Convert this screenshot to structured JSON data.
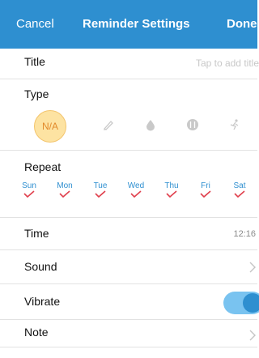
{
  "navbar": {
    "cancel": "Cancel",
    "title": "Reminder Settings",
    "done": "Done"
  },
  "title_row": {
    "label": "Title",
    "placeholder": "Tap to add title"
  },
  "type_row": {
    "label": "Type",
    "selected": "N/A",
    "icons": [
      "pen-icon",
      "drop-icon",
      "fork-knife-icon",
      "exercise-icon"
    ]
  },
  "repeat_row": {
    "label": "Repeat",
    "days": [
      {
        "name": "Sun",
        "checked": true
      },
      {
        "name": "Mon",
        "checked": true
      },
      {
        "name": "Tue",
        "checked": true
      },
      {
        "name": "Wed",
        "checked": true
      },
      {
        "name": "Thu",
        "checked": true
      },
      {
        "name": "Fri",
        "checked": true
      },
      {
        "name": "Sat",
        "checked": true
      }
    ]
  },
  "time_row": {
    "label": "Time",
    "value": "12:16"
  },
  "sound_row": {
    "label": "Sound"
  },
  "vibrate_row": {
    "label": "Vibrate",
    "on": true
  },
  "note_row": {
    "label": "Note"
  },
  "colors": {
    "accent": "#2e8fd0",
    "selected_fill": "#fde3a2",
    "check": "#e0414e"
  }
}
